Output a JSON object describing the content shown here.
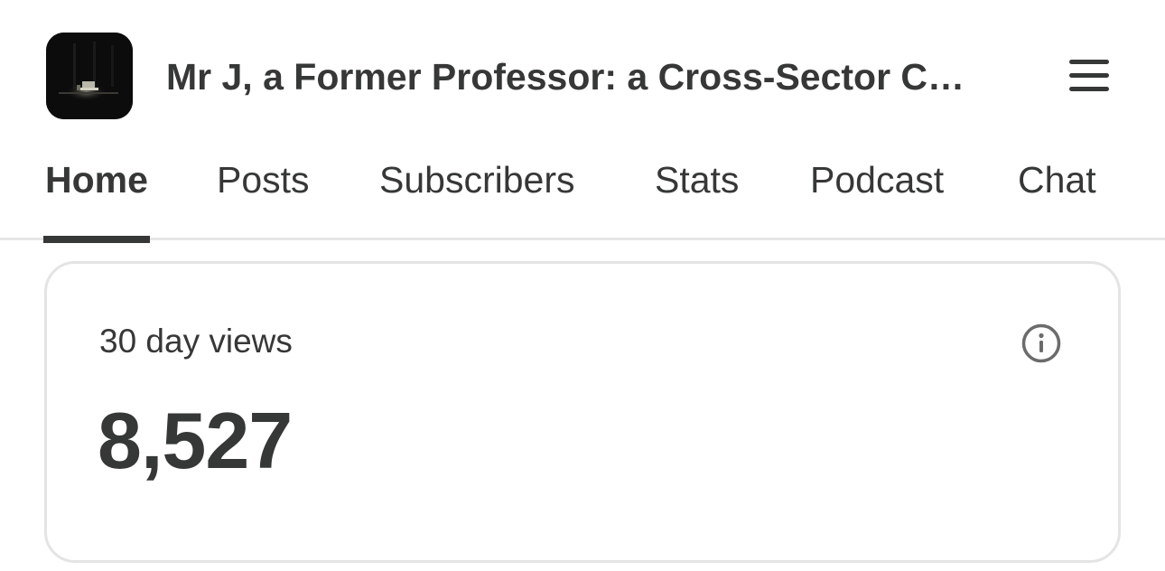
{
  "header": {
    "logo_icon": "publication-logo",
    "title": "Mr J, a Former Professor: a Cross-Sector C…",
    "menu_icon": "hamburger-menu-icon"
  },
  "tabs": [
    {
      "label": "Home",
      "active": true
    },
    {
      "label": "Posts",
      "active": false
    },
    {
      "label": "Subscribers",
      "active": false
    },
    {
      "label": "Stats",
      "active": false
    },
    {
      "label": "Podcast",
      "active": false
    },
    {
      "label": "Chat",
      "active": false
    }
  ],
  "stat_card": {
    "label": "30 day views",
    "value": "8,527",
    "info_icon": "info-icon"
  },
  "colors": {
    "text": "#363737",
    "border": "#e4e4e4",
    "background": "#ffffff"
  }
}
